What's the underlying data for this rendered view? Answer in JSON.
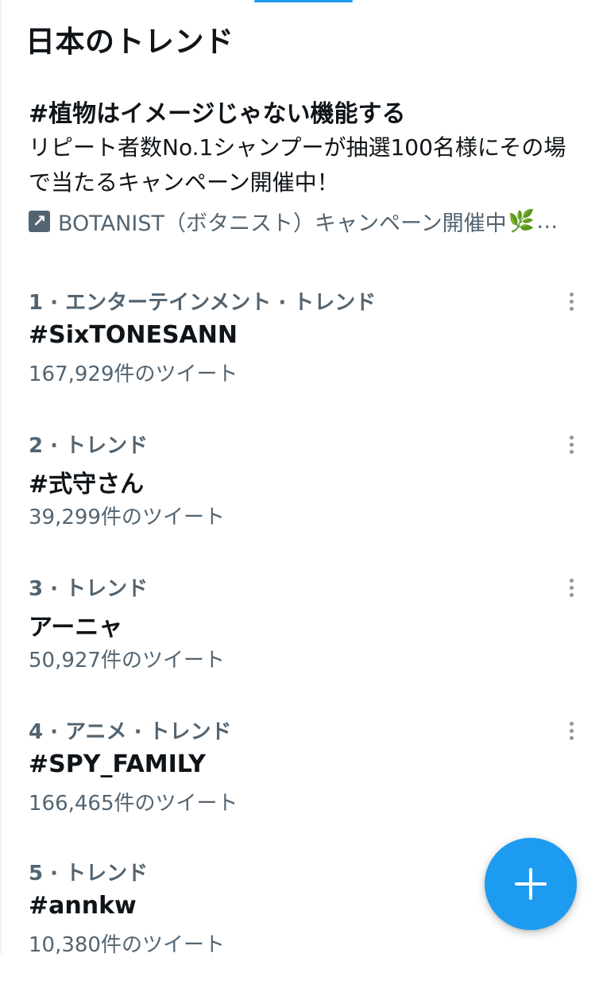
{
  "header": {
    "title": "日本のトレンド"
  },
  "promoted": {
    "title": "#植物はイメージじゃない機能する",
    "description": "リピート者数No.1シャンプーが抽選100名様にその場で当たるキャンペーン開催中！",
    "promoted_by": "BOTANIST（ボタニスト）キャンペーン開催中",
    "leaf_glyph": "🌿",
    "ellipsis": "…",
    "icon": "promoted-arrow-icon"
  },
  "trends": [
    {
      "meta": "1 · エンターテインメント · トレンド",
      "name": "#SixTONESANN",
      "count": "167,929件のツイート"
    },
    {
      "meta": "2 · トレンド",
      "name": "#式守さん",
      "count": "39,299件のツイート"
    },
    {
      "meta": "3 · トレンド",
      "name": "アーニャ",
      "count": "50,927件のツイート"
    },
    {
      "meta": "4 · アニメ · トレンド",
      "name": "#SPY_FAMILY",
      "count": "166,465件のツイート"
    },
    {
      "meta": "5 · トレンド",
      "name": "#annkw",
      "count": "10,380件のツイート"
    }
  ],
  "fab": {
    "icon": "plus-icon"
  },
  "colors": {
    "accent": "#1d9bf0",
    "text_primary": "#0f1419",
    "text_secondary": "#536471"
  }
}
